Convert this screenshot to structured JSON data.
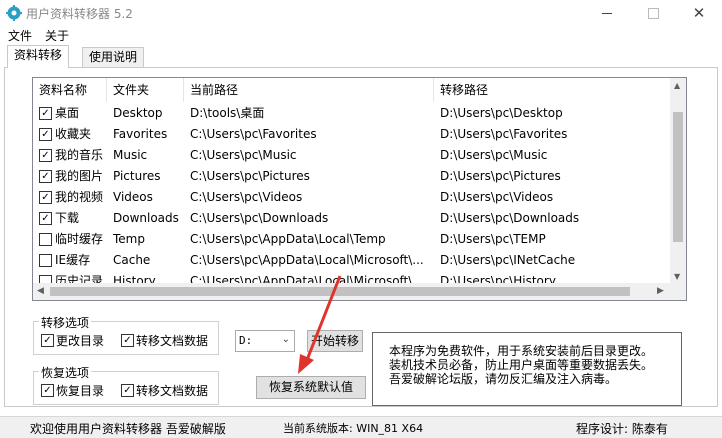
{
  "window": {
    "title": "用户资料转移器 5.2"
  },
  "menu": [
    "文件",
    "关于"
  ],
  "tabs": [
    "资料转移",
    "使用说明"
  ],
  "table": {
    "columns": [
      "资料名称",
      "文件夹",
      "当前路径",
      "转移路径"
    ],
    "rows": [
      {
        "checked": true,
        "name": "桌面",
        "folder": "Desktop",
        "current": "D:\\tools\\桌面",
        "target": "D:\\Users\\pc\\Desktop"
      },
      {
        "checked": true,
        "name": "收藏夹",
        "folder": "Favorites",
        "current": "C:\\Users\\pc\\Favorites",
        "target": "D:\\Users\\pc\\Favorites"
      },
      {
        "checked": true,
        "name": "我的音乐",
        "folder": "Music",
        "current": "C:\\Users\\pc\\Music",
        "target": "D:\\Users\\pc\\Music"
      },
      {
        "checked": true,
        "name": "我的图片",
        "folder": "Pictures",
        "current": "C:\\Users\\pc\\Pictures",
        "target": "D:\\Users\\pc\\Pictures"
      },
      {
        "checked": true,
        "name": "我的视频",
        "folder": "Videos",
        "current": "C:\\Users\\pc\\Videos",
        "target": "D:\\Users\\pc\\Videos"
      },
      {
        "checked": true,
        "name": "下载",
        "folder": "Downloads",
        "current": "C:\\Users\\pc\\Downloads",
        "target": "D:\\Users\\pc\\Downloads"
      },
      {
        "checked": false,
        "name": "临时缓存",
        "folder": "Temp",
        "current": "C:\\Users\\pc\\AppData\\Local\\Temp",
        "target": "D:\\Users\\pc\\TEMP"
      },
      {
        "checked": false,
        "name": "IE缓存",
        "folder": "Cache",
        "current": "C:\\Users\\pc\\AppData\\Local\\Microsoft\\...",
        "target": "D:\\Users\\pc\\INetCache"
      },
      {
        "checked": false,
        "name": "历史记录",
        "folder": "History",
        "current": "C:\\Users\\pc\\AppData\\Local\\Microsoft\\...",
        "target": "D:\\Users\\pc\\History"
      }
    ]
  },
  "transfer_options": {
    "title": "转移选项",
    "opt1": "更改目录",
    "opt2": "转移文档数据"
  },
  "restore_options": {
    "title": "恢复选项",
    "opt1": "恢复目录",
    "opt2": "转移文档数据"
  },
  "drive_select": {
    "value": "D:"
  },
  "buttons": {
    "start": "开始转移",
    "restore_default": "恢复系统默认值"
  },
  "info": {
    "line1": "本程序为免费软件，用于系统安装前后目录更改。",
    "line2": "装机技术员必备，防止用户桌面等重要数据丢失。",
    "line3": "吾爱破解论坛版，请勿反汇编及注入病毒。"
  },
  "status": {
    "left": "欢迎使用用户资料转移器 吾爱破解版",
    "middle": "当前系统版本: WIN_81 X64",
    "right": "程序设计: 陈泰有"
  },
  "colors": {
    "accent": "#2aa0c8",
    "arrow": "#e0332b"
  }
}
